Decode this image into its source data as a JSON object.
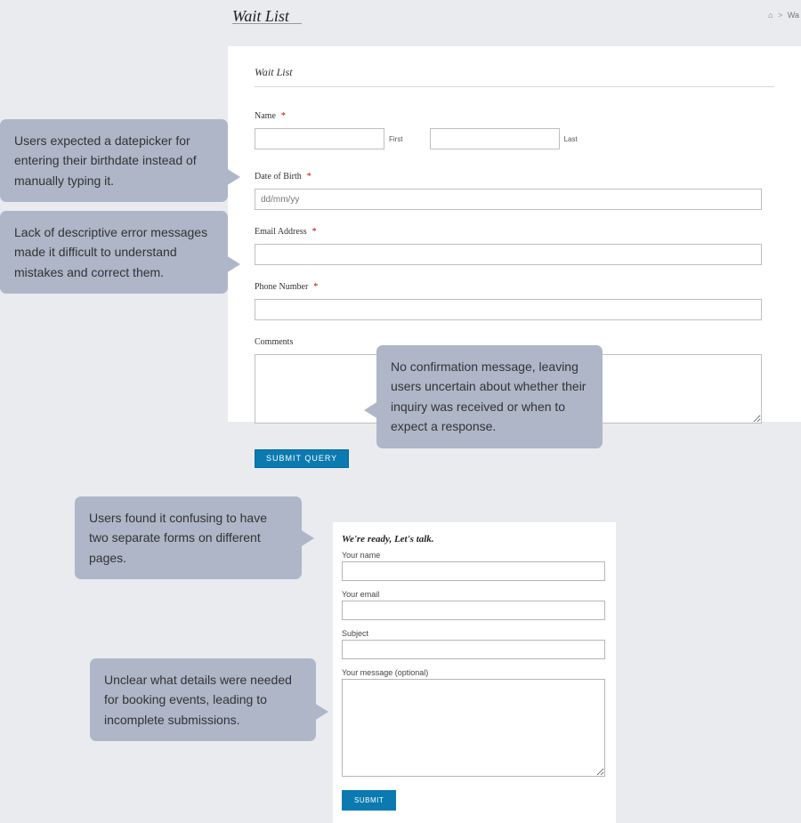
{
  "header": {
    "page_title": "Wait List",
    "breadcrumb_current": "Wa"
  },
  "waitlist_form": {
    "title": "Wait List",
    "name_label": "Name",
    "first_label": "First",
    "last_label": "Last",
    "dob_label": "Date of Birth",
    "dob_placeholder": "dd/mm/yy",
    "email_label": "Email Address",
    "phone_label": "Phone Number",
    "comments_label": "Comments",
    "submit_label": "SUBMIT QUERY"
  },
  "contact_form": {
    "title": "We're ready, Let's talk.",
    "name_label": "Your name",
    "email_label": "Your email",
    "subject_label": "Subject",
    "message_label": "Your message (optional)",
    "submit_label": "SUBMIT"
  },
  "callouts": {
    "c1": "Users expected a datepicker for entering their birthdate instead of manually typing it.",
    "c2": "Lack of descriptive error messages made it difficult to understand mistakes and correct them.",
    "c3": "No confirmation message, leaving users uncertain about whether their inquiry was received or when to expect a response.",
    "c4": "Users found it confusing to have two separate forms on different pages.",
    "c5": "Unclear what details were needed for booking events, leading to incomplete submissions."
  }
}
